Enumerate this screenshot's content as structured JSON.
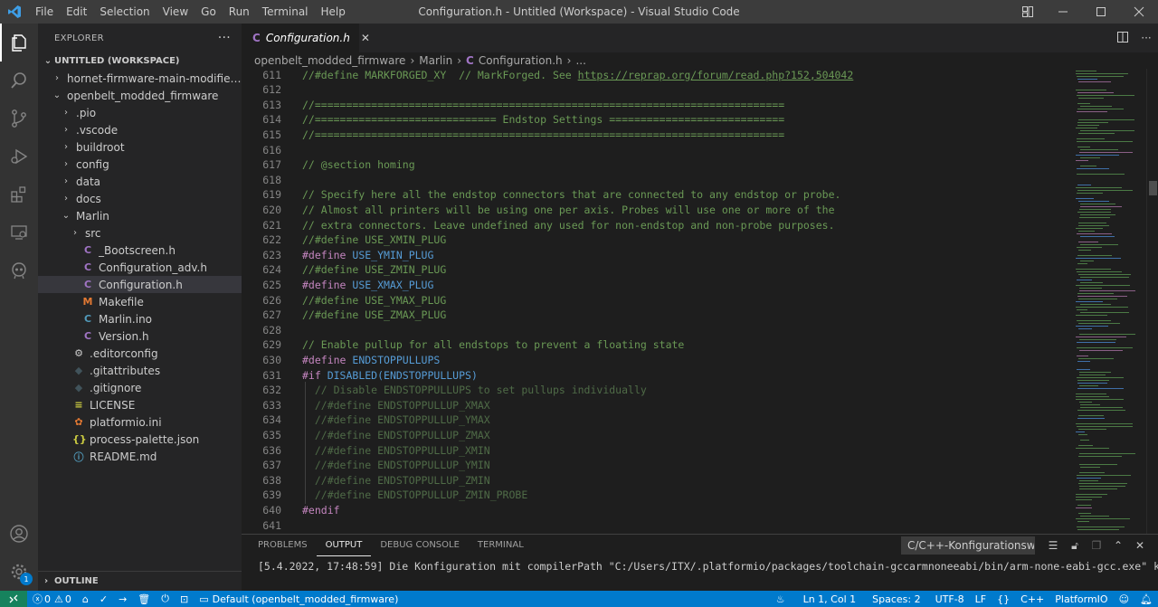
{
  "titlebar": {
    "menus": [
      "File",
      "Edit",
      "Selection",
      "View",
      "Go",
      "Run",
      "Terminal",
      "Help"
    ],
    "window_title": "Configuration.h - Untitled (Workspace) - Visual Studio Code"
  },
  "sidebar": {
    "title": "EXPLORER",
    "more_label": "···",
    "workspace": "UNTITLED (WORKSPACE)",
    "outline": "OUTLINE",
    "tree": [
      {
        "label": "hornet-firmware-main-modified-for-...",
        "depth": 1,
        "chevron": "›",
        "icon": ""
      },
      {
        "label": "openbelt_modded_firmware",
        "depth": 1,
        "chevron": "⌄",
        "icon": ""
      },
      {
        "label": ".pio",
        "depth": 2,
        "chevron": "›",
        "icon": ""
      },
      {
        "label": ".vscode",
        "depth": 2,
        "chevron": "›",
        "icon": ""
      },
      {
        "label": "buildroot",
        "depth": 2,
        "chevron": "›",
        "icon": ""
      },
      {
        "label": "config",
        "depth": 2,
        "chevron": "›",
        "icon": ""
      },
      {
        "label": "data",
        "depth": 2,
        "chevron": "›",
        "icon": ""
      },
      {
        "label": "docs",
        "depth": 2,
        "chevron": "›",
        "icon": ""
      },
      {
        "label": "Marlin",
        "depth": 2,
        "chevron": "⌄",
        "icon": ""
      },
      {
        "label": "src",
        "depth": 3,
        "chevron": "›",
        "icon": ""
      },
      {
        "label": "_Bootscreen.h",
        "depth": 3,
        "chevron": "",
        "icon": "C"
      },
      {
        "label": "Configuration_adv.h",
        "depth": 3,
        "chevron": "",
        "icon": "C"
      },
      {
        "label": "Configuration.h",
        "depth": 3,
        "chevron": "",
        "icon": "C",
        "selected": true
      },
      {
        "label": "Makefile",
        "depth": 3,
        "chevron": "",
        "icon": "M"
      },
      {
        "label": "Marlin.ino",
        "depth": 3,
        "chevron": "",
        "icon": "ino"
      },
      {
        "label": "Version.h",
        "depth": 3,
        "chevron": "",
        "icon": "C"
      },
      {
        "label": ".editorconfig",
        "depth": 2,
        "chevron": "",
        "icon": "gear"
      },
      {
        "label": ".gitattributes",
        "depth": 2,
        "chevron": "",
        "icon": "git"
      },
      {
        "label": ".gitignore",
        "depth": 2,
        "chevron": "",
        "icon": "git"
      },
      {
        "label": "LICENSE",
        "depth": 2,
        "chevron": "",
        "icon": "lic"
      },
      {
        "label": "platformio.ini",
        "depth": 2,
        "chevron": "",
        "icon": "pio"
      },
      {
        "label": "process-palette.json",
        "depth": 2,
        "chevron": "",
        "icon": "json"
      },
      {
        "label": "README.md",
        "depth": 2,
        "chevron": "",
        "icon": "info"
      }
    ]
  },
  "editor": {
    "tab_label": "Configuration.h",
    "tab_icon": "C",
    "tab_close": "✕",
    "breadcrumb": [
      "openbelt_modded_firmware",
      "Marlin",
      "Configuration.h",
      "..."
    ],
    "lines": [
      {
        "n": "611",
        "segs": [
          [
            "cm",
            "//#define MARKFORGED_XY  // MarkForged. See "
          ],
          [
            "cmu",
            "https://reprap.org/forum/read.php?152,504042"
          ]
        ]
      },
      {
        "n": "612",
        "segs": []
      },
      {
        "n": "613",
        "segs": [
          [
            "cm",
            "//==========================================================================="
          ]
        ]
      },
      {
        "n": "614",
        "segs": [
          [
            "cm",
            "//============================= Endstop Settings ============================"
          ]
        ]
      },
      {
        "n": "615",
        "segs": [
          [
            "cm",
            "//==========================================================================="
          ]
        ]
      },
      {
        "n": "616",
        "segs": []
      },
      {
        "n": "617",
        "segs": [
          [
            "cm",
            "// @section homing"
          ]
        ]
      },
      {
        "n": "618",
        "segs": []
      },
      {
        "n": "619",
        "segs": [
          [
            "cm",
            "// Specify here all the endstop connectors that are connected to any endstop or probe."
          ]
        ]
      },
      {
        "n": "620",
        "segs": [
          [
            "cm",
            "// Almost all printers will be using one per axis. Probes will use one or more of the"
          ]
        ]
      },
      {
        "n": "621",
        "segs": [
          [
            "cm",
            "// extra connectors. Leave undefined any used for non-endstop and non-probe purposes."
          ]
        ]
      },
      {
        "n": "622",
        "segs": [
          [
            "cm",
            "//#define USE_XMIN_PLUG"
          ]
        ]
      },
      {
        "n": "623",
        "segs": [
          [
            "pp",
            "#define "
          ],
          [
            "mc",
            "USE_YMIN_PLUG"
          ]
        ]
      },
      {
        "n": "624",
        "segs": [
          [
            "cm",
            "//#define USE_ZMIN_PLUG"
          ]
        ]
      },
      {
        "n": "625",
        "segs": [
          [
            "pp",
            "#define "
          ],
          [
            "mc",
            "USE_XMAX_PLUG"
          ]
        ]
      },
      {
        "n": "626",
        "segs": [
          [
            "cm",
            "//#define USE_YMAX_PLUG"
          ]
        ]
      },
      {
        "n": "627",
        "segs": [
          [
            "cm",
            "//#define USE_ZMAX_PLUG"
          ]
        ]
      },
      {
        "n": "628",
        "segs": []
      },
      {
        "n": "629",
        "segs": [
          [
            "cm",
            "// Enable pullup for all endstops to prevent a floating state"
          ]
        ]
      },
      {
        "n": "630",
        "segs": [
          [
            "pp",
            "#define "
          ],
          [
            "mc",
            "ENDSTOPPULLUPS"
          ]
        ]
      },
      {
        "n": "631",
        "segs": [
          [
            "pp",
            "#if "
          ],
          [
            "mc",
            "DISABLED(ENDSTOPPULLUPS)"
          ]
        ]
      },
      {
        "n": "632",
        "segs": [
          [
            "dim",
            "  // Disable ENDSTOPPULLUPS to set pullups individually"
          ]
        ]
      },
      {
        "n": "633",
        "segs": [
          [
            "dim",
            "  //#define ENDSTOPPULLUP_XMAX"
          ]
        ]
      },
      {
        "n": "634",
        "segs": [
          [
            "dim",
            "  //#define ENDSTOPPULLUP_YMAX"
          ]
        ]
      },
      {
        "n": "635",
        "segs": [
          [
            "dim",
            "  //#define ENDSTOPPULLUP_ZMAX"
          ]
        ]
      },
      {
        "n": "636",
        "segs": [
          [
            "dim",
            "  //#define ENDSTOPPULLUP_XMIN"
          ]
        ]
      },
      {
        "n": "637",
        "segs": [
          [
            "dim",
            "  //#define ENDSTOPPULLUP_YMIN"
          ]
        ]
      },
      {
        "n": "638",
        "segs": [
          [
            "dim",
            "  //#define ENDSTOPPULLUP_ZMIN"
          ]
        ]
      },
      {
        "n": "639",
        "segs": [
          [
            "dim",
            "  //#define ENDSTOPPULLUP_ZMIN_PROBE"
          ]
        ]
      },
      {
        "n": "640",
        "segs": [
          [
            "pp",
            "#endif"
          ]
        ]
      },
      {
        "n": "641",
        "segs": []
      }
    ]
  },
  "panel": {
    "tabs": [
      "PROBLEMS",
      "OUTPUT",
      "DEBUG CONSOLE",
      "TERMINAL"
    ],
    "active_tab": "OUTPUT",
    "channel": "C/C++-Konfigurationsw",
    "output_line": "[5.4.2022, 17:48:59] Die Konfiguration mit compilerPath \"C:/Users/ITX/.platformio/packages/toolchain-gccarmnoneeabi/bin/arm-none-eabi-gcc.exe\" kann"
  },
  "statusbar": {
    "errors": "0",
    "warnings": "0",
    "env": "Default (openbelt_modded_firmware)",
    "position": "Ln 1, Col 1",
    "spaces": "Spaces: 2",
    "encoding": "UTF-8",
    "eol": "LF",
    "language": "C++",
    "platform": "PlatformIO"
  },
  "activity": {
    "accounts_badge": "1"
  },
  "colors": {
    "accent": "#007acc",
    "remote": "#16825d",
    "c_icon": "#a074c4"
  }
}
